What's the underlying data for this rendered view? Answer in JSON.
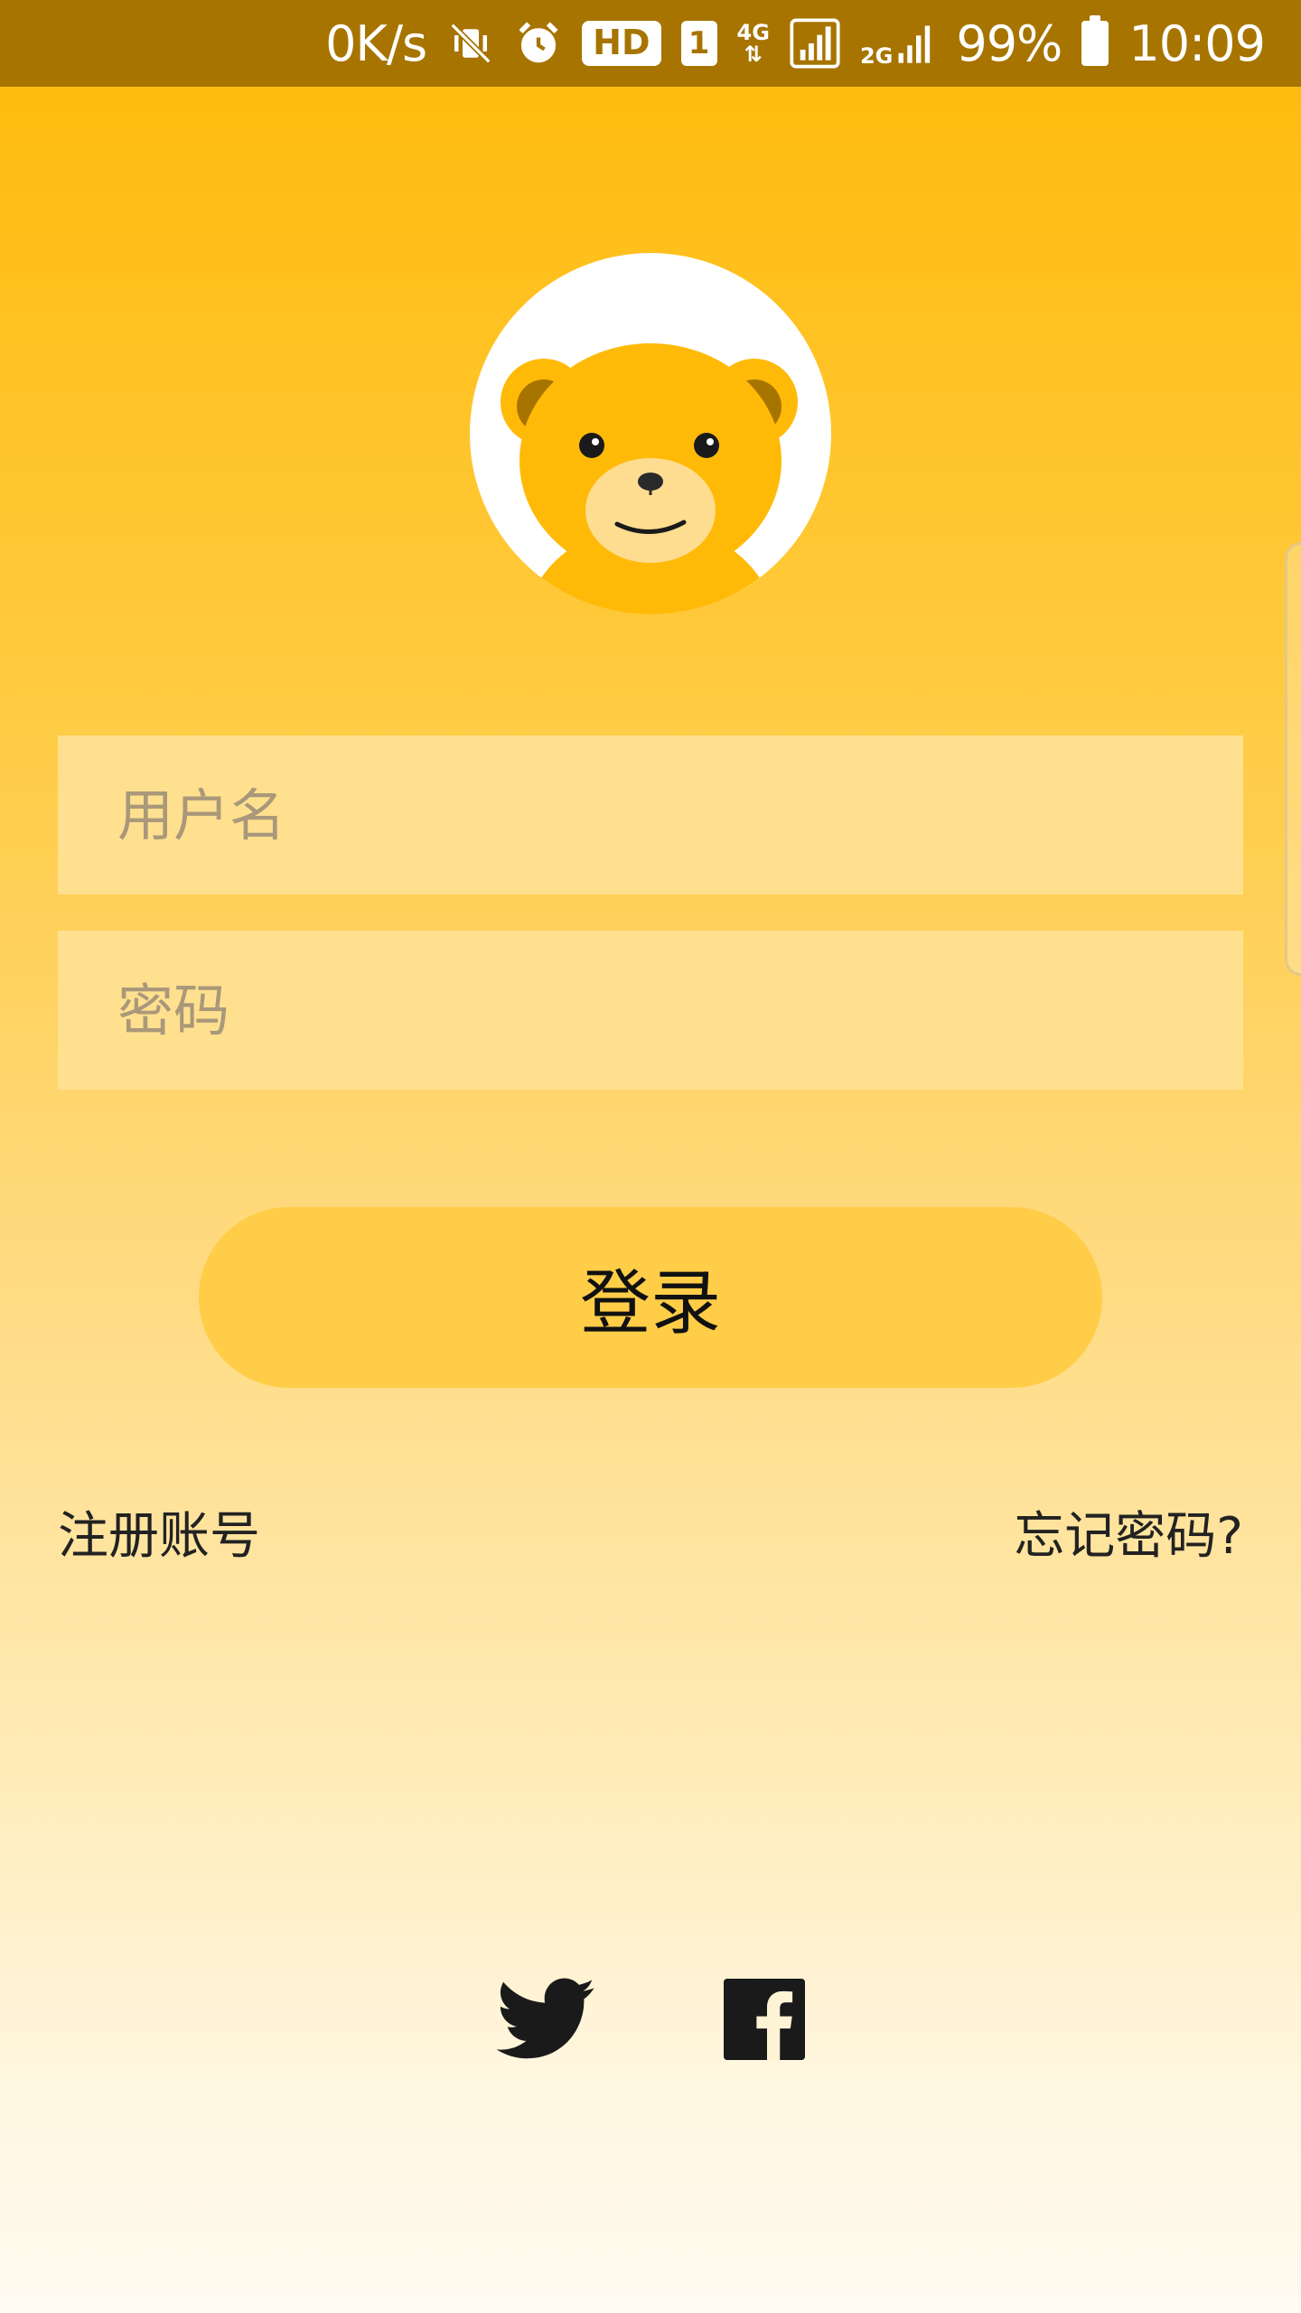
{
  "status_bar": {
    "net_speed": "0K/s",
    "hd_label": "HD",
    "sim_label": "1",
    "net_4g": "4G",
    "net_2g": "2G",
    "battery": "99%",
    "time": "10:09",
    "background": "#A77400"
  },
  "login_form": {
    "username_placeholder": "用户名",
    "password_placeholder": "密码",
    "login_label": "登录"
  },
  "links": {
    "register": "注册账号",
    "forgot_password": "忘记密码?"
  },
  "social": {
    "icons": [
      "twitter-icon",
      "facebook-icon"
    ]
  },
  "colors": {
    "accent": "#FFBA08",
    "field_bg": "#FFE08F",
    "button_bg": "#FFCD48"
  }
}
